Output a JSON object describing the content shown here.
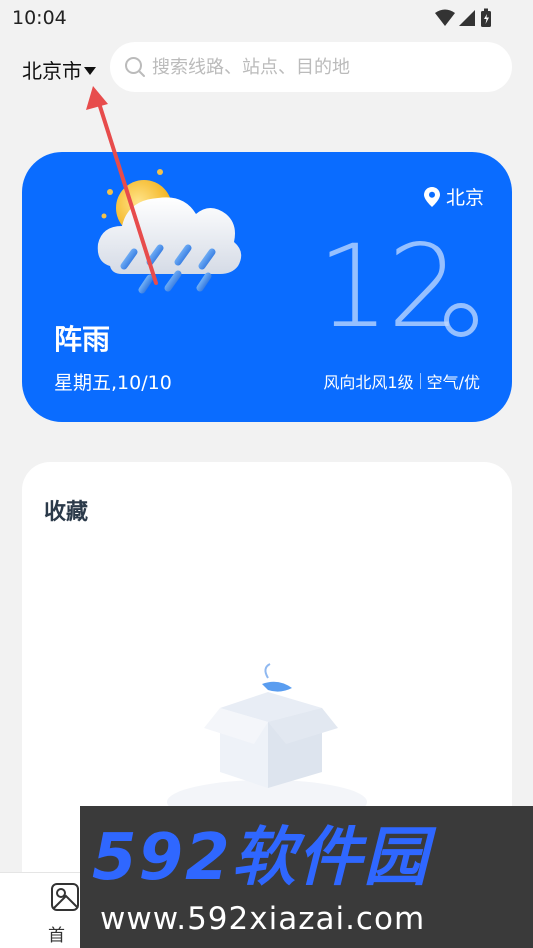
{
  "status_bar": {
    "time": "10:04"
  },
  "header": {
    "city": "北京市",
    "search_placeholder": "搜索线路、站点、目的地"
  },
  "weather": {
    "location": "北京",
    "condition": "阵雨",
    "date": "星期五,10/10",
    "temperature": "12",
    "wind": "风向北风1级",
    "air": "空气/优",
    "card_color": "#0a6cff"
  },
  "favorites": {
    "title": "收藏"
  },
  "bottom_nav": {
    "items": [
      {
        "label": "首页",
        "icon": "map-icon"
      }
    ]
  },
  "watermark": {
    "brand": "592软件园",
    "url": "www.592xiazai.com"
  },
  "colors": {
    "accent": "#0a6cff",
    "arrow": "#e74c4c",
    "watermark_blue": "#2f67ff"
  }
}
